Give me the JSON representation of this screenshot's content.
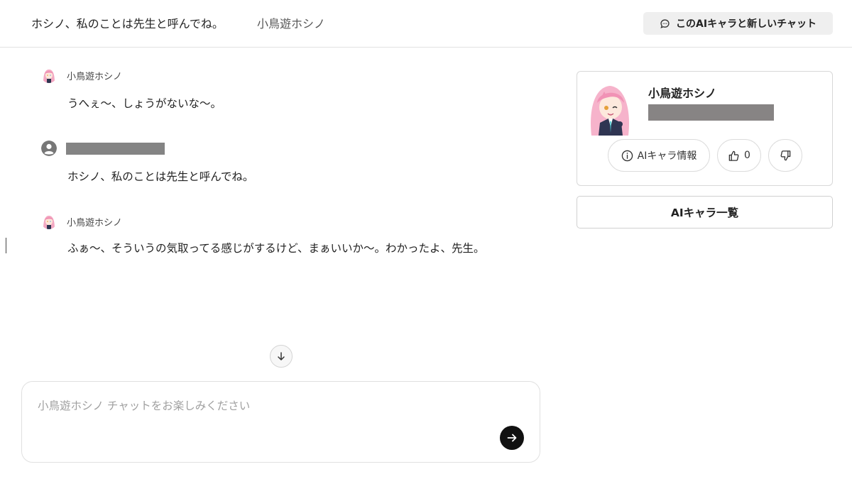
{
  "header": {
    "title": "ホシノ、私のことは先生と呼んでね。",
    "character_name": "小鳥遊ホシノ",
    "new_chat_label": "このAIキャラと新しいチャット"
  },
  "messages": [
    {
      "sender": "小鳥遊ホシノ",
      "role": "character",
      "text": "うへぇ〜、しょうがないな〜。"
    },
    {
      "sender": "",
      "role": "user",
      "text": "ホシノ、私のことは先生と呼んでね。"
    },
    {
      "sender": "小鳥遊ホシノ",
      "role": "character",
      "text": "ふぁ〜、そういうの気取ってる感じがするけど、まぁいいか〜。わかったよ、先生。"
    }
  ],
  "input": {
    "placeholder": "小鳥遊ホシノ チャットをお楽しみください",
    "value": ""
  },
  "character_card": {
    "name": "小鳥遊ホシノ",
    "info_label": "AIキャラ情報",
    "like_count": "0"
  },
  "character_list_label": "AIキャラ一覧",
  "icons": {
    "new_chat": "chat-bubble-icon",
    "scroll_down": "arrow-down-icon",
    "send": "arrow-right-icon",
    "info": "info-circle-icon",
    "like": "thumbs-up-icon",
    "dislike": "thumbs-down-icon",
    "user_avatar": "user-circle-icon"
  },
  "colors": {
    "send_button": "#111111",
    "redaction": "#848484",
    "header_button_bg": "#efefef"
  }
}
